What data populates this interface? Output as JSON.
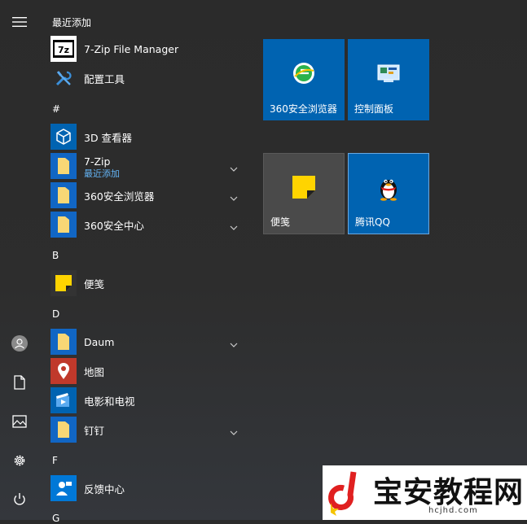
{
  "sections": {
    "recent": "最近添加",
    "hash": "#",
    "b": "B",
    "d": "D",
    "f": "F",
    "g": "G"
  },
  "apps": {
    "zip_fm": "7-Zip File Manager",
    "config_tool": "配置工具",
    "viewer3d": "3D 查看器",
    "zip": "7-Zip",
    "zip_sub": "最近添加",
    "browser360": "360安全浏览器",
    "center360": "360安全中心",
    "sticky": "便笺",
    "daum": "Daum",
    "maps": "地图",
    "movies": "电影和电视",
    "dingtalk": "钉钉",
    "feedback": "反馈中心"
  },
  "tiles": {
    "browser360": "360安全浏览器",
    "control_panel": "控制面板",
    "sticky": "便笺",
    "qq": "腾讯QQ"
  },
  "watermark": {
    "title": "宝安教程网",
    "url": "hcjhd.com"
  },
  "colors": {
    "accent": "#0063b1",
    "tile_gray": "#4a4a4a",
    "folder_yellow": "#f8d775",
    "link_blue": "#64b5f6"
  }
}
